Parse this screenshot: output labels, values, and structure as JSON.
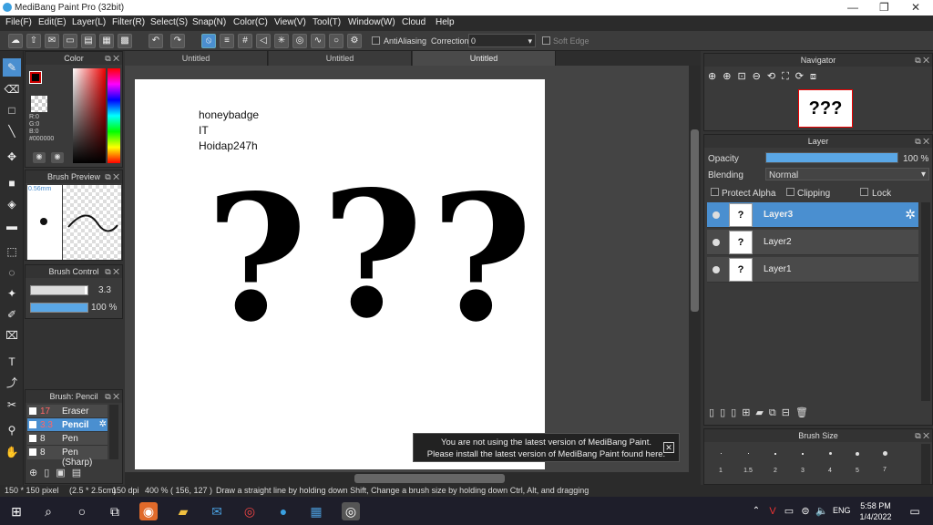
{
  "window": {
    "title": "MediBang Paint Pro (32bit)",
    "controls": [
      "—",
      "❐",
      "✕"
    ]
  },
  "menu": [
    "File(F)",
    "Edit(E)",
    "Layer(L)",
    "Filter(R)",
    "Select(S)",
    "Snap(N)",
    "Color(C)",
    "View(V)",
    "Tool(T)",
    "Window(W)",
    "Cloud",
    "Help"
  ],
  "toolbar": {
    "antialiasing_label": "AntiAliasing",
    "correction_label": "Correction",
    "correction_value": "0",
    "soft_edge_label": "Soft Edge"
  },
  "tabs": [
    "Untitled",
    "Untitled",
    "Untitled"
  ],
  "color_panel": {
    "title": "Color",
    "r": "R:0",
    "g": "G:0",
    "b": "B:0",
    "hex": "#000000"
  },
  "brush_preview": {
    "title": "Brush Preview",
    "size": "0.56mm"
  },
  "brush_control": {
    "title": "Brush Control",
    "size_value": "3.3",
    "opacity_value": "100 %",
    "size_fraction": 0.95,
    "opacity_fraction": 1.0
  },
  "brush_list": {
    "title": "Brush: Pencil",
    "items": [
      {
        "size": "17",
        "name": "Eraser"
      },
      {
        "size": "3.3",
        "name": "Pencil"
      },
      {
        "size": "8",
        "name": "Pen"
      },
      {
        "size": "8",
        "name": "Pen (Sharp)"
      }
    ]
  },
  "canvas": {
    "lines": [
      "honeybadge",
      "IT",
      "Hoidap247h"
    ],
    "marks": [
      "?",
      "?",
      "?"
    ]
  },
  "notice": {
    "line1": "You are not using the latest version of MediBang Paint.",
    "line2": "Please install the latest version of MediBang Paint found here."
  },
  "navigator": {
    "title": "Navigator",
    "preview_text": "???"
  },
  "layer_panel": {
    "title": "Layer",
    "opacity_label": "Opacity",
    "opacity_value": "100 %",
    "opacity_fraction": 1.0,
    "blending_label": "Blending",
    "blending_value": "Normal",
    "protect_alpha": "Protect Alpha",
    "clipping": "Clipping",
    "lock": "Lock",
    "layers": [
      {
        "name": "Layer3",
        "thumb": "?"
      },
      {
        "name": "Layer2",
        "thumb": "?"
      },
      {
        "name": "Layer1",
        "thumb": "?"
      }
    ]
  },
  "brush_size": {
    "title": "Brush Size",
    "sizes": [
      "1",
      "1.5",
      "2",
      "3",
      "4",
      "5",
      "7"
    ]
  },
  "status": {
    "dims": "150 * 150 pixel",
    "cm": "(2.5 * 2.5cm)",
    "dpi": "150 dpi",
    "zoom": "400 %",
    "coords": "( 156, 127 )",
    "hint": "Draw a straight line by holding down Shift, Change a brush size by holding down Ctrl, Alt, and dragging"
  },
  "taskbar": {
    "time": "5:58 PM",
    "date": "1/4/2022",
    "lang": "ENG"
  },
  "colors": {
    "accent": "#4a8fd0",
    "foreground": "#000000"
  }
}
